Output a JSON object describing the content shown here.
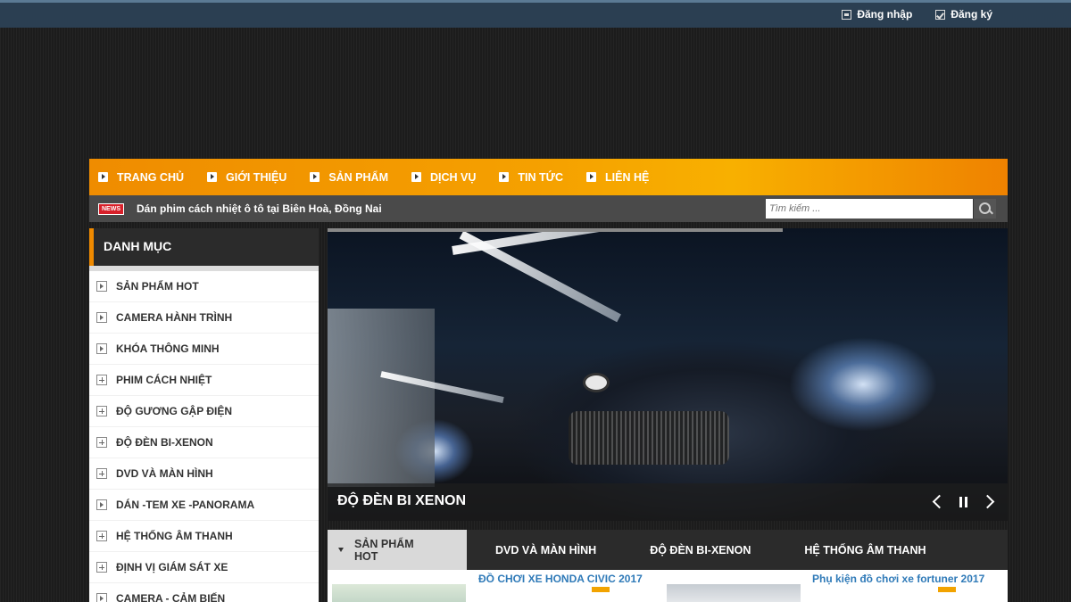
{
  "topbar": {
    "login_label": "Đăng nhập",
    "register_label": "Đăng ký"
  },
  "nav": {
    "items": [
      {
        "label": "TRANG CHỦ"
      },
      {
        "label": "GIỚI THIỆU"
      },
      {
        "label": "SẢN PHẨM"
      },
      {
        "label": "DỊCH VỤ"
      },
      {
        "label": "TIN TỨC"
      },
      {
        "label": "LIÊN HỆ"
      }
    ]
  },
  "news": {
    "badge": "NEWS",
    "headline": "Dán phim cách nhiệt ô tô tại Biên Hoà, Đồng Nai"
  },
  "search": {
    "placeholder": "Tìm kiếm ..."
  },
  "sidebar": {
    "title": "DANH MỤC",
    "items": [
      {
        "label": "SẢN PHẨM HOT",
        "icon": "arrow"
      },
      {
        "label": "CAMERA HÀNH TRÌNH",
        "icon": "arrow"
      },
      {
        "label": "KHÓA THÔNG MINH",
        "icon": "arrow"
      },
      {
        "label": "PHIM CÁCH NHIỆT",
        "icon": "plus"
      },
      {
        "label": "ĐỘ GƯƠNG GẬP ĐIỆN",
        "icon": "plus"
      },
      {
        "label": "ĐỘ ĐÈN BI-XENON",
        "icon": "plus"
      },
      {
        "label": "DVD VÀ MÀN HÌNH",
        "icon": "plus"
      },
      {
        "label": "DÁN -TEM XE -PANORAMA",
        "icon": "arrow"
      },
      {
        "label": "HỆ THỐNG ÂM THANH",
        "icon": "plus"
      },
      {
        "label": "ĐỊNH VỊ GIÁM SÁT XE",
        "icon": "plus"
      },
      {
        "label": "CAMERA - CẢM BIẾN",
        "icon": "arrow"
      }
    ]
  },
  "slider": {
    "caption": "ĐỘ ĐÈN BI XENON"
  },
  "tabs": {
    "items": [
      {
        "label": "SẢN PHẨM HOT"
      },
      {
        "label": "DVD VÀ MÀN HÌNH"
      },
      {
        "label": "ĐỘ ĐÈN BI-XENON"
      },
      {
        "label": "HỆ THỐNG ÂM THANH"
      }
    ]
  },
  "products": [
    {
      "title": "ĐỒ CHƠI XE HONDA CIVIC 2017"
    },
    {
      "title": "Phụ kiện đồ chơi xe fortuner 2017"
    }
  ],
  "colors": {
    "accent": "#f08a00",
    "topbar": "#2b3f52",
    "link": "#2f7ab8"
  }
}
